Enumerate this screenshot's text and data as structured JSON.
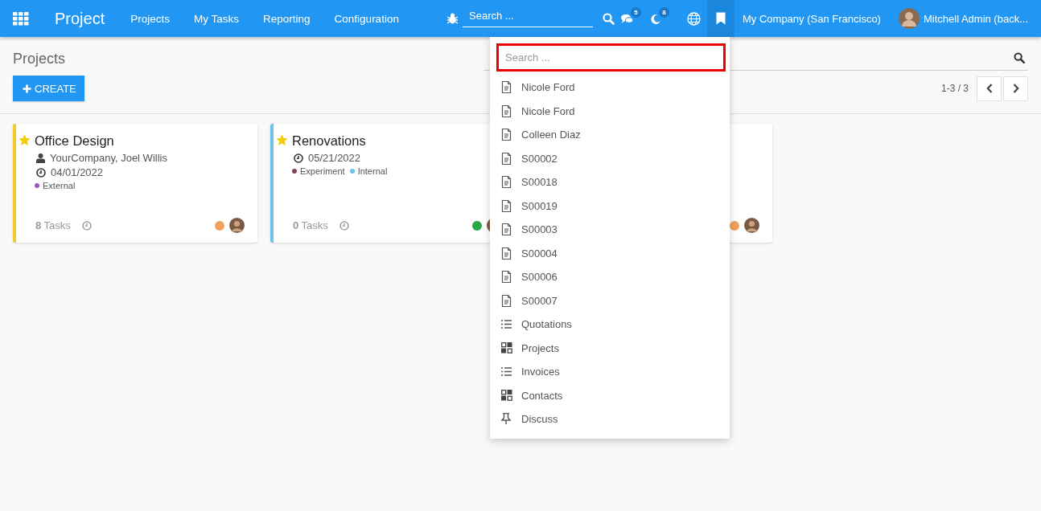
{
  "navbar": {
    "app_name": "Project",
    "menu": [
      "Projects",
      "My Tasks",
      "Reporting",
      "Configuration"
    ],
    "search": {
      "placeholder": "Search ..."
    },
    "messages_count": "5",
    "activities_count": "8",
    "bookmarks_open": true,
    "company": "My Company (San Francisco)",
    "user": "Mitchell Admin (back..."
  },
  "control_panel": {
    "breadcrumb": "Projects",
    "create_button": "CREATE",
    "pager": "1-3 / 3"
  },
  "cards": [
    {
      "title": "Office Design",
      "starred": true,
      "color": "#f4cc2a",
      "customer": "YourCompany, Joel Willis",
      "date": "04/01/2022",
      "tags": [
        {
          "label": "External",
          "color": "#9b59b6"
        }
      ],
      "tasks": "**8** Tasks",
      "status_dot": {
        "color": "#f0a05a"
      }
    },
    {
      "title": "Renovations",
      "starred": true,
      "color": "#6cc1ed",
      "date": "05/21/2022",
      "tags": [
        {
          "label": "Experiment",
          "color": "#804060"
        },
        {
          "label": "Internal",
          "color": "#6cc1ed"
        }
      ],
      "tasks": "**0** Tasks",
      "status_dot": {
        "color": "#28a745"
      }
    },
    {
      "status_dot": {
        "color": "#f0a05a"
      }
    }
  ],
  "bookmarks_dropdown": {
    "search": {
      "placeholder": "Search ..."
    },
    "items": [
      {
        "kind": "record",
        "label": "Nicole Ford"
      },
      {
        "kind": "record",
        "label": "Nicole Ford"
      },
      {
        "kind": "record",
        "label": "Colleen Diaz"
      },
      {
        "kind": "record",
        "label": "S00002"
      },
      {
        "kind": "record",
        "label": "S00018"
      },
      {
        "kind": "record",
        "label": "S00019"
      },
      {
        "kind": "record",
        "label": "S00003"
      },
      {
        "kind": "record",
        "label": "S00004"
      },
      {
        "kind": "record",
        "label": "S00006"
      },
      {
        "kind": "record",
        "label": "S00007"
      },
      {
        "kind": "list",
        "label": "Quotations"
      },
      {
        "kind": "kanban",
        "label": "Projects"
      },
      {
        "kind": "list",
        "label": "Invoices"
      },
      {
        "kind": "kanban",
        "label": "Contacts"
      },
      {
        "kind": "pin",
        "label": "Discuss"
      }
    ]
  }
}
